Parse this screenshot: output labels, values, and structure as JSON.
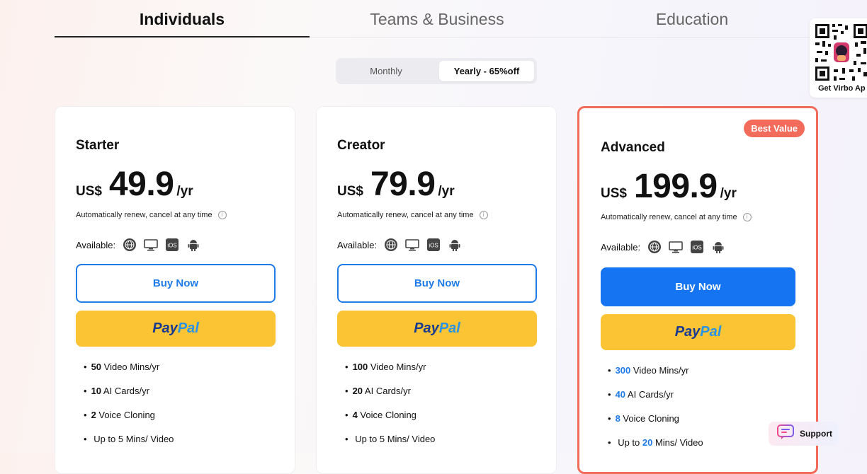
{
  "tabs": [
    {
      "label": "Individuals",
      "active": true
    },
    {
      "label": "Teams & Business",
      "active": false
    },
    {
      "label": "Education",
      "active": false
    }
  ],
  "qr": {
    "label": "Get Virbo Ap"
  },
  "billing": {
    "monthly": "Monthly",
    "yearly": "Yearly - 65%off",
    "selected": "yearly"
  },
  "common": {
    "currency": "US$",
    "period": "/yr",
    "renew": "Automatically renew, cancel at any time",
    "available_label": "Available:",
    "buy_label": "Buy Now",
    "paypal_pay": "Pay",
    "paypal_pal": "Pal",
    "platform_icons": [
      "globe-icon",
      "desktop-icon",
      "ios-icon",
      "android-icon"
    ]
  },
  "plans": [
    {
      "name": "Starter",
      "price": "49.9",
      "badge": "",
      "features": [
        {
          "num": "50",
          "text": " Video Mins/yr"
        },
        {
          "num": "10",
          "text": " AI Cards/yr"
        },
        {
          "num": "2",
          "text": " Voice Cloning"
        },
        {
          "pre": "Up to 5 Mins/ Video"
        }
      ]
    },
    {
      "name": "Creator",
      "price": "79.9",
      "badge": "",
      "features": [
        {
          "num": "100",
          "text": " Video Mins/yr"
        },
        {
          "num": "20",
          "text": " AI Cards/yr"
        },
        {
          "num": "4",
          "text": " Voice Cloning"
        },
        {
          "pre": "Up to 5 Mins/ Video"
        }
      ]
    },
    {
      "name": "Advanced",
      "price": "199.9",
      "badge": "Best Value",
      "features": [
        {
          "num": "300",
          "text": " Video Mins/yr"
        },
        {
          "num": "40",
          "text": " AI Cards/yr"
        },
        {
          "num": "8",
          "text": " Voice Cloning"
        },
        {
          "pre": "Up to ",
          "num": "20",
          "text": " Mins/ Video"
        }
      ]
    }
  ],
  "support": {
    "label": "Support"
  },
  "colors": {
    "accent": "#1574f1",
    "featured_border": "#f26b5b",
    "paypal_bg": "#fbc434"
  }
}
